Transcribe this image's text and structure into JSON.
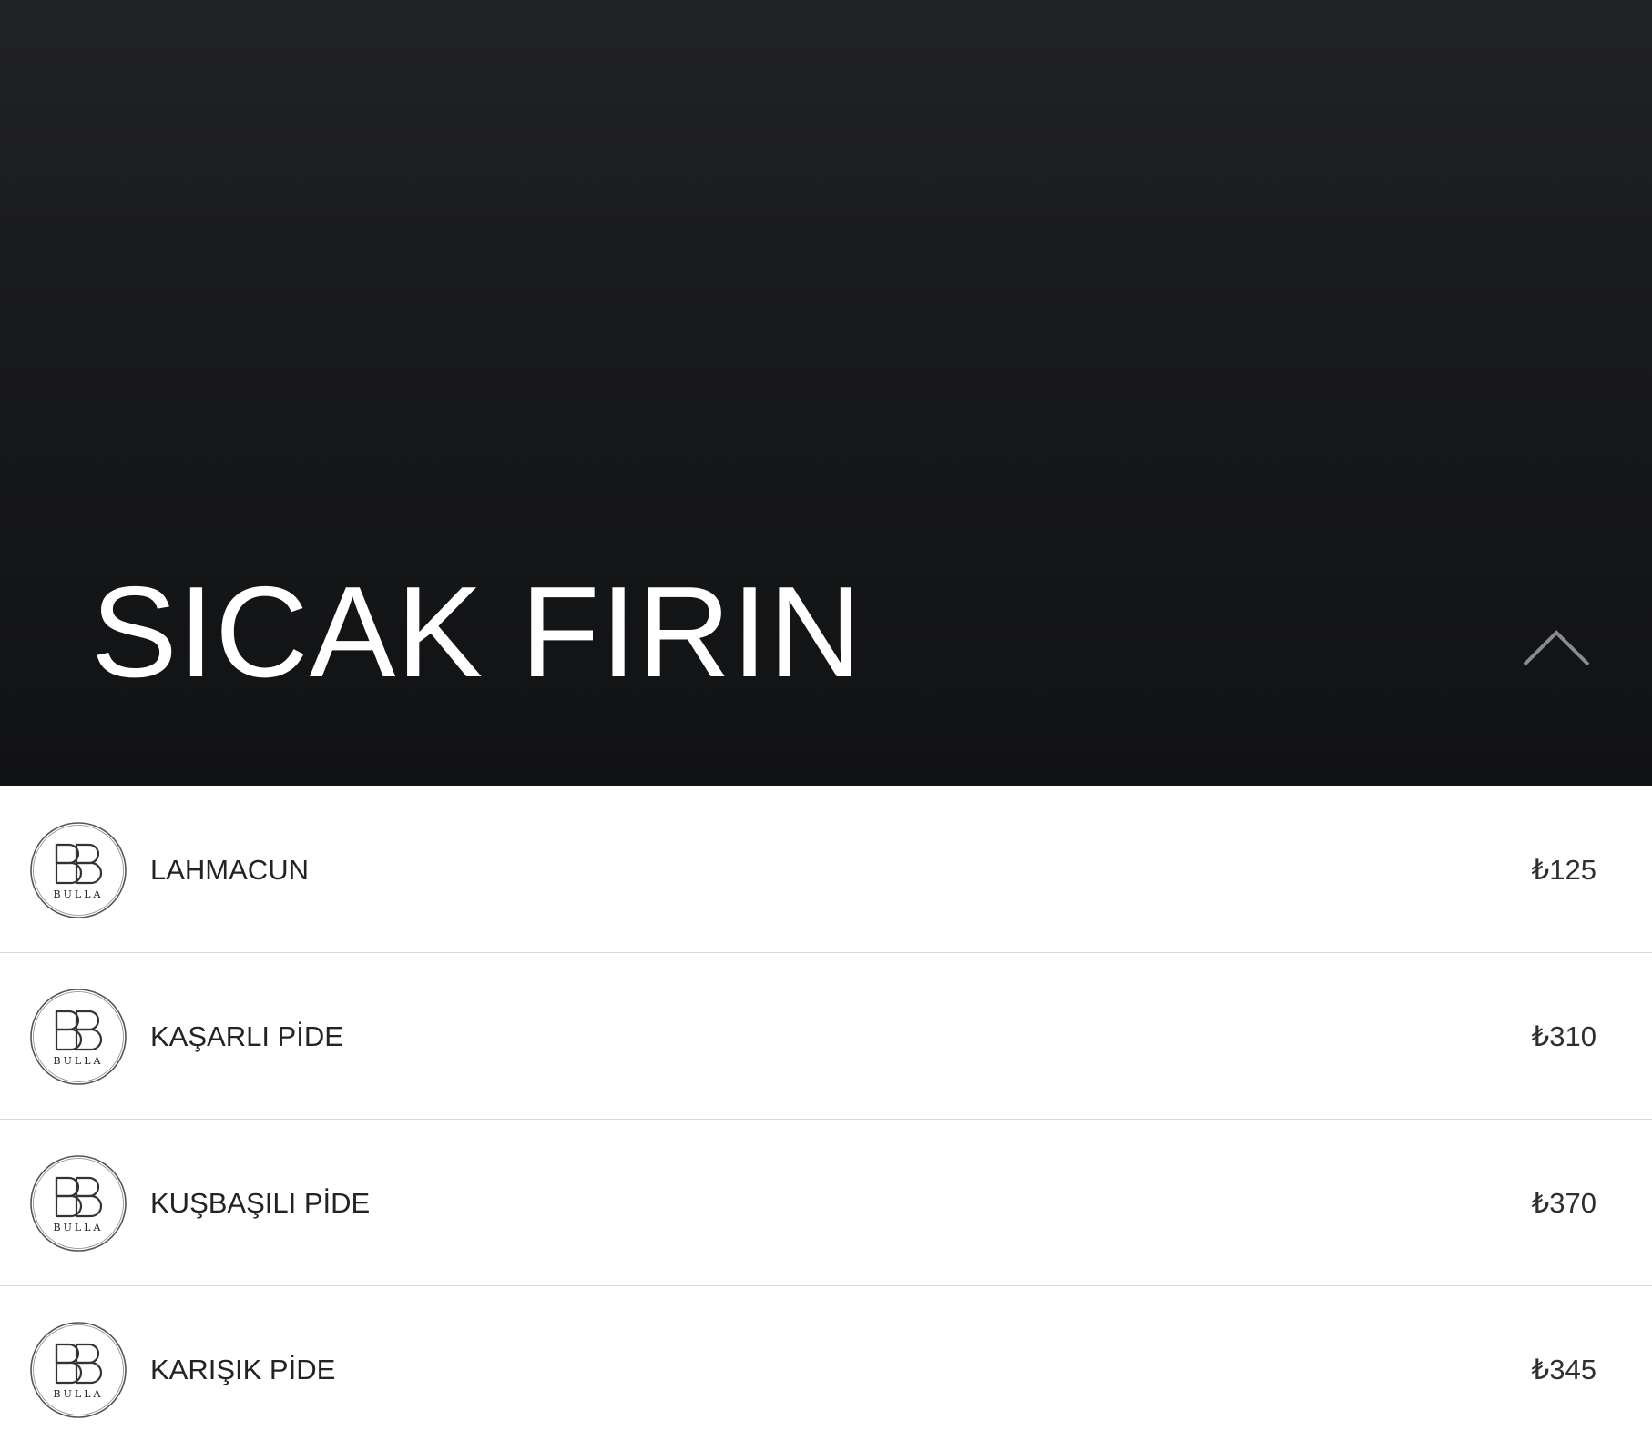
{
  "category": {
    "title": "SICAK FIRIN",
    "toggle_icon": "chevron-up-icon"
  },
  "brand": {
    "logo_text": "BULLA",
    "logo_icon": "bulla-bb-monogram-icon"
  },
  "items": [
    {
      "name": "LAHMACUN",
      "price": "₺125"
    },
    {
      "name": "KAŞARLI PİDE",
      "price": "₺310"
    },
    {
      "name": "KUŞBAŞILI PİDE",
      "price": "₺370"
    },
    {
      "name": "KARIŞIK PİDE",
      "price": "₺345"
    }
  ],
  "colors": {
    "hero_background": "#18191b",
    "text_dark": "#222326",
    "divider": "#d9d9d9",
    "chevron": "#8a8b8e"
  }
}
